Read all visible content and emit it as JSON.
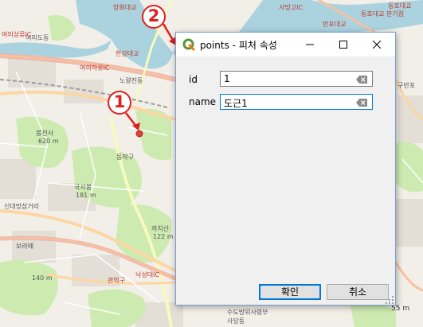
{
  "dialog": {
    "title": "points - 피처 속성",
    "icon": "qgis-logo-icon",
    "accent_color": "#0078d7",
    "fields": [
      {
        "label": "id",
        "value": "1"
      },
      {
        "label": "name",
        "value": "도근1"
      }
    ],
    "ok_label": "확인",
    "cancel_label": "취소"
  },
  "annotations": [
    "1",
    "2"
  ],
  "map": {
    "water_color": "#aad3df",
    "land_color": "#f2efe9",
    "park_color": "#cdebb0",
    "marker_color": "#e0403a",
    "labels": [
      {
        "text": "양화대교"
      },
      {
        "text": "여의도동"
      },
      {
        "text": "여의상류IC"
      },
      {
        "text": "여의하류IC"
      },
      {
        "text": "한강대교"
      },
      {
        "text": "노량진동"
      },
      {
        "text": "봉천사"
      },
      {
        "text": "620 m"
      },
      {
        "text": "동작구"
      },
      {
        "text": "국사봉"
      },
      {
        "text": "181 m"
      },
      {
        "text": "까치산"
      },
      {
        "text": "122 m"
      },
      {
        "text": "신대방삼거리"
      },
      {
        "text": "관악구"
      },
      {
        "text": "140 m"
      },
      {
        "text": "낙성대IC"
      },
      {
        "text": "동호대교"
      },
      {
        "text": "동호대교 분기점"
      },
      {
        "text": "반포대교"
      },
      {
        "text": "서빙고IC"
      },
      {
        "text": "구반포"
      },
      {
        "text": "보라매"
      },
      {
        "text": "수도방위사령부"
      },
      {
        "text": "사당동"
      }
    ]
  },
  "scale_bar": {
    "text": "55 m"
  }
}
